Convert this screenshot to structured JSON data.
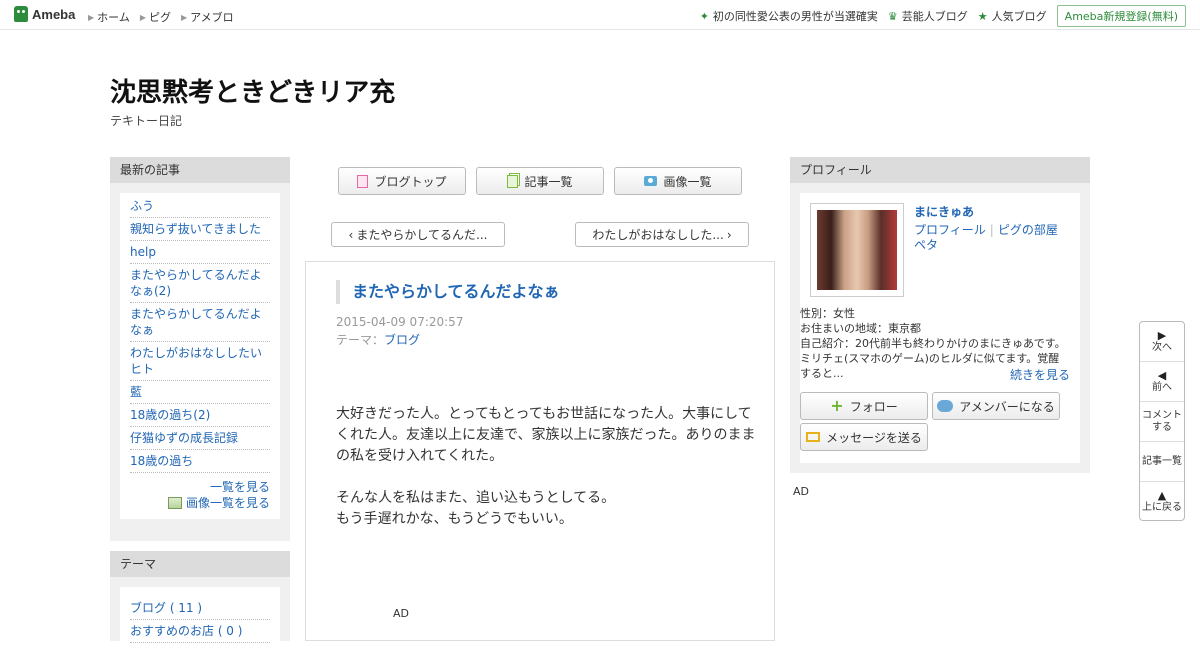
{
  "topbar": {
    "logo": "Ameba",
    "nav": [
      "ホーム",
      "ピグ",
      "アメブロ"
    ],
    "right_links": [
      {
        "label": "初の同性愛公表の男性が当選確実",
        "icon": "sparkle-icon"
      },
      {
        "label": "芸能人ブログ",
        "icon": "crown-icon"
      },
      {
        "label": "人気ブログ",
        "icon": "star-icon"
      }
    ],
    "register": "Ameba新規登録(無料)"
  },
  "header": {
    "title": "沈思黙考ときどきリア充",
    "subtitle": "テキトー日記"
  },
  "recent": {
    "heading": "最新の記事",
    "items": [
      "ふう",
      "親知らず抜いてきました",
      "help",
      "またやらかしてるんだよなぁ(2)",
      "またやらかしてるんだよなぁ",
      "わたしがおはなししたいヒト",
      "藍",
      "18歳の過ち(2)",
      "仔猫ゆずの成長記録",
      "18歳の過ち"
    ],
    "see_all": "一覧を見る",
    "see_images": "画像一覧を見る"
  },
  "theme": {
    "heading": "テーマ",
    "items": [
      "ブログ ( 11 )",
      "おすすめのお店 ( 0 )"
    ]
  },
  "toolbar": {
    "blog_top": "ブログトップ",
    "article_list": "記事一覧",
    "image_list": "画像一覧"
  },
  "pager": {
    "prev": "またやらかしてるんだ...",
    "next": "わたしがおはなしした..."
  },
  "article": {
    "title": "またやらかしてるんだよなぁ",
    "date": "2015-04-09 07:20:57",
    "theme_label": "テーマ：",
    "theme_value": "ブログ",
    "body": [
      "大好きだった人。とってもとってもお世話になった人。大事にしてくれた人。友達以上に友達で、家族以上に家族だった。ありのままの私を受け入れてくれた。",
      "そんな人を私はまた、追い込もうとしてる。",
      "もう手遅れかな、もうどうでもいい。"
    ],
    "ad": "AD"
  },
  "profile": {
    "heading": "プロフィール",
    "name": "まにきゅあ",
    "link_profile": "プロフィール",
    "link_pig": "ピグの部屋",
    "link_peta": "ペタ",
    "gender": "性別：女性",
    "location": "お住まいの地域：東京都",
    "intro": "自己紹介：20代前半も終わりかけのまにきゅあです。ミリチェ(スマホのゲーム)のヒルダに似てます。覚醒すると...",
    "more": "続きを見る",
    "follow": "フォロー",
    "amember": "アメンバーになる",
    "message": "メッセージを送る",
    "ad": "AD"
  },
  "floatnav": {
    "next": "次へ",
    "prev": "前へ",
    "comment_1": "コメント",
    "comment_2": "する",
    "list": "記事一覧",
    "top": "上に戻る"
  }
}
